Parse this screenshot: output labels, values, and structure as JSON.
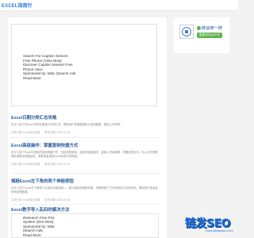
{
  "site": {
    "title": "EXCEL指南针"
  },
  "ad_top": {
    "lines": [
      "Search For Caption Seniors",
      "Free Phone (View Now)",
      "Discover Caption Seniors Free",
      "Phone Here",
      "Sponsored by: Misc |Search Ads",
      "Read More"
    ]
  },
  "articles": [
    {
      "title": "Excel日期分类汇总攻略",
      "desc": "本文介绍了在Excel中按日期进行分类汇总，帮助用户快速整理统计各项数据，提高工作效率。",
      "author": "文章分类: Excel常见问题",
      "date": "发布日期: 2025-03-26"
    },
    {
      "title": "Excel高级操作：掌握复制快捷方式",
      "desc": "本文介绍了Excel中常用的复制快捷方式，包括常规复制、选择性粘贴格式、复制公式结果等，掌握这些技巧，可以让您的数据处理更加快捷高效，帮助读者提高Excel的操作熟练度。",
      "author": "文章分类: Excel常见问题",
      "date": "发布日期: 2025-03-26"
    },
    {
      "title": "揭秘Excel左下角的两个神秘按钮",
      "desc": "本文介绍了Excel左下角两个实用的功能按钮——表示缩放和视图切换，详解帮助了它们的使用方法和作用，帮助用户更加高效地处理数据。",
      "author": "文章分类: Excel常见问题",
      "date": "发布日期: 2025-03-26"
    },
    {
      "title": "Excel数字导入乱码的解决方法",
      "desc": "",
      "author": "",
      "date": ""
    }
  ],
  "ad_bottom": {
    "lines": [
      "Research Free Pos",
      "System (See Now)",
      "Sponsored by: Misc",
      "|Search Ads",
      "Read More"
    ]
  },
  "side": {
    "wechat_label": "微信搜一搜",
    "follow_button": "查看本站公众号"
  },
  "watermark": {
    "text": "链发SEO",
    "url": "www.liantaoseo.com"
  },
  "colors": {
    "link": "#2c5d9c",
    "brand": "#2a7ae4",
    "wechat_green": "#5db24c",
    "watermark_blue": "#1e6fd6"
  }
}
